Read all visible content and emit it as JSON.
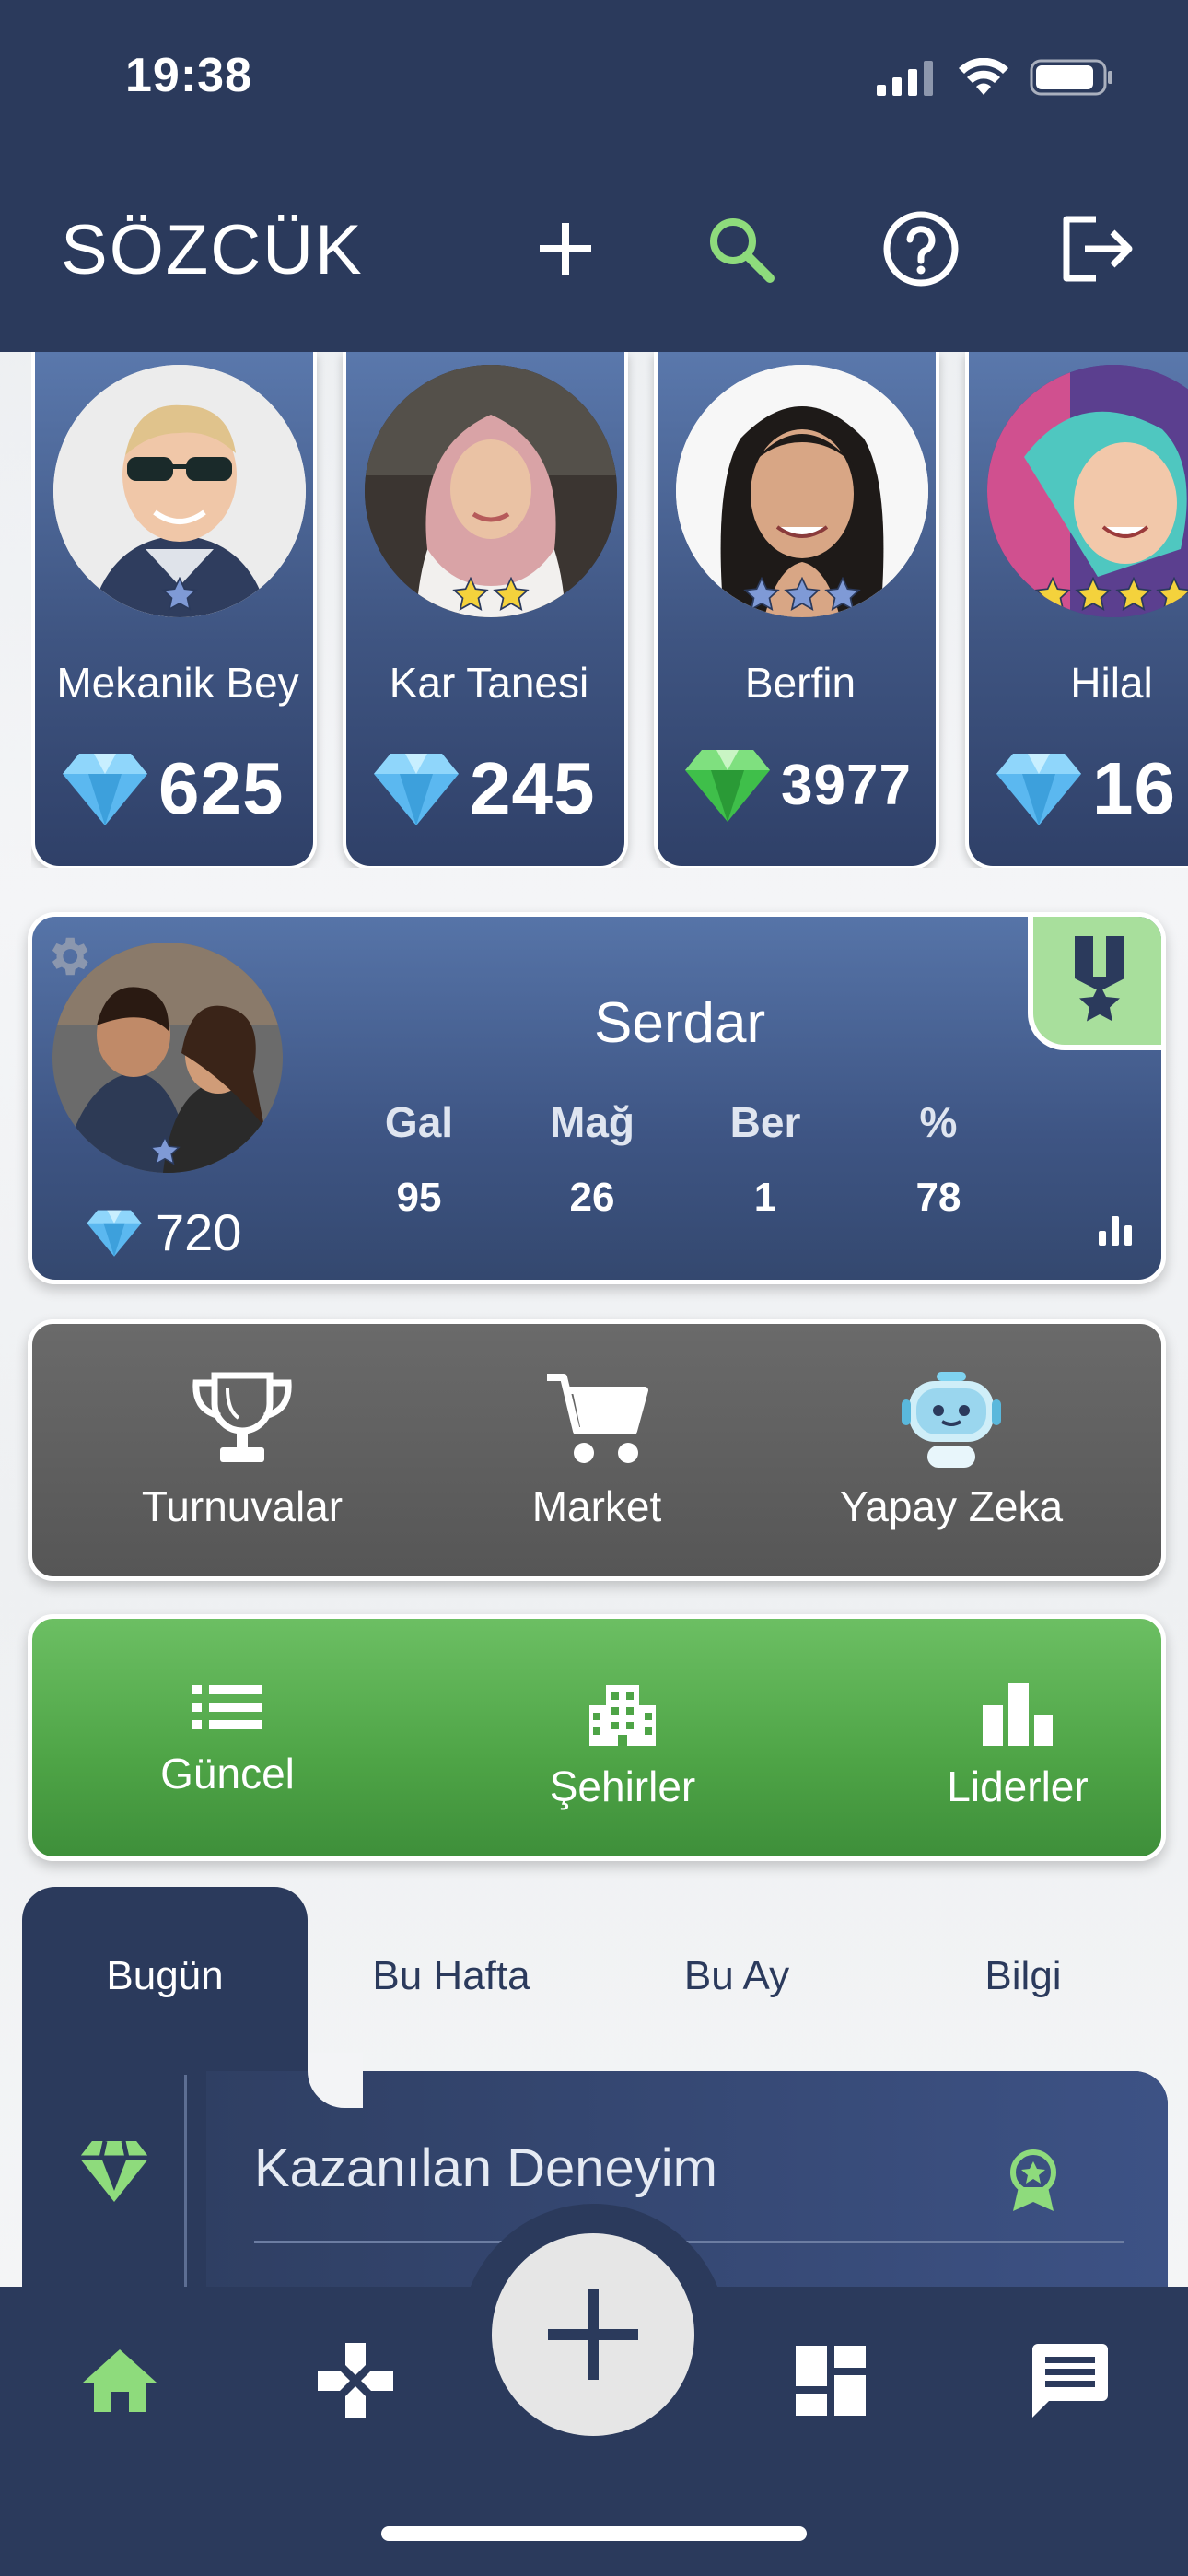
{
  "status_bar": {
    "time": "19:38"
  },
  "header": {
    "title": "SÖZCÜK"
  },
  "players": [
    {
      "name": "Mekanik Bey",
      "score": "625",
      "gem": "blue",
      "stars": 1
    },
    {
      "name": "Kar Tanesi",
      "score": "245",
      "gem": "blue",
      "stars": 2
    },
    {
      "name": "Berfin",
      "score": "3977",
      "gem": "green",
      "stars": 3
    },
    {
      "name": "Hilal",
      "score": "16",
      "gem": "blue",
      "stars": 4
    }
  ],
  "profile": {
    "name": "Serdar",
    "gems": "720",
    "stats": [
      {
        "label": "Gal",
        "value": "95"
      },
      {
        "label": "Mağ",
        "value": "26"
      },
      {
        "label": "Ber",
        "value": "1"
      },
      {
        "label": "%",
        "value": "78"
      }
    ]
  },
  "menu": {
    "tournaments": "Turnuvalar",
    "market": "Market",
    "ai": "Yapay Zeka"
  },
  "green_menu": {
    "current": "Güncel",
    "cities": "Şehirler",
    "leaders": "Liderler"
  },
  "tabs": [
    "Bugün",
    "Bu Hafta",
    "Bu Ay",
    "Bilgi"
  ],
  "section": {
    "title": "Kazanılan Deneyim"
  },
  "colors": {
    "navy": "#2b3a5c",
    "accent_green": "#8edb7c",
    "gem_blue": "#5bb8f0",
    "gem_green": "#3fbf4a",
    "star_gold": "#f4d23c",
    "star_blue": "#7f9ad6"
  }
}
